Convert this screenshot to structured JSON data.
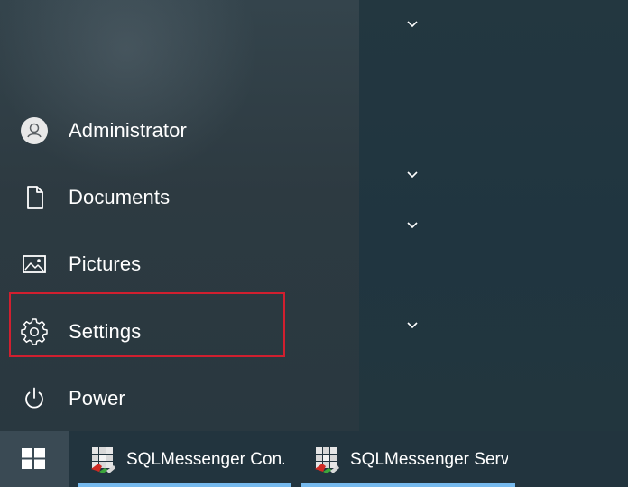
{
  "start_menu": {
    "nav_items": [
      {
        "label": "Administrator",
        "icon": "user-avatar-icon"
      },
      {
        "label": "Documents",
        "icon": "document-icon"
      },
      {
        "label": "Pictures",
        "icon": "pictures-icon"
      },
      {
        "label": "Settings",
        "icon": "gear-icon",
        "highlighted": true
      },
      {
        "label": "Power",
        "icon": "power-icon"
      }
    ],
    "group_collapsers": [
      {
        "icon": "chevron-down-icon"
      },
      {
        "icon": "chevron-down-icon"
      },
      {
        "icon": "chevron-down-icon"
      },
      {
        "icon": "chevron-down-icon"
      }
    ],
    "highlight_color": "#d11f2f"
  },
  "taskbar": {
    "start_icon": "windows-logo-icon",
    "apps": [
      {
        "label": "SQLMessenger Con...",
        "icon": "sqlmessenger-icon",
        "active": true
      },
      {
        "label": "SQLMessenger Serv...",
        "icon": "sqlmessenger-icon",
        "active": true
      }
    ],
    "active_indicator_color": "#76b9ed"
  }
}
